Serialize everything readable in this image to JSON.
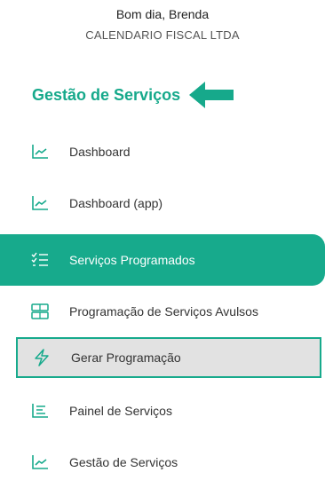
{
  "user": {
    "greeting": "Bom dia, Brenda",
    "company": "CALENDARIO FISCAL LTDA"
  },
  "section": {
    "title": "Gestão de Serviços"
  },
  "menu": {
    "items": [
      {
        "label": "Dashboard",
        "icon": "chart-line-icon"
      },
      {
        "label": "Dashboard (app)",
        "icon": "chart-line-icon"
      },
      {
        "label": "Serviços Programados",
        "icon": "checklist-icon",
        "state": "active"
      },
      {
        "label": "Programação de Serviços Avulsos",
        "icon": "server-icon"
      },
      {
        "label": "Gerar Programação",
        "icon": "lightning-icon",
        "state": "highlighted"
      },
      {
        "label": "Painel de Serviços",
        "icon": "list-icon"
      },
      {
        "label": "Gestão de Serviços",
        "icon": "chart-line-icon"
      }
    ]
  },
  "colors": {
    "accent": "#17aa8c",
    "highlight_bg": "#e2e2e2"
  }
}
